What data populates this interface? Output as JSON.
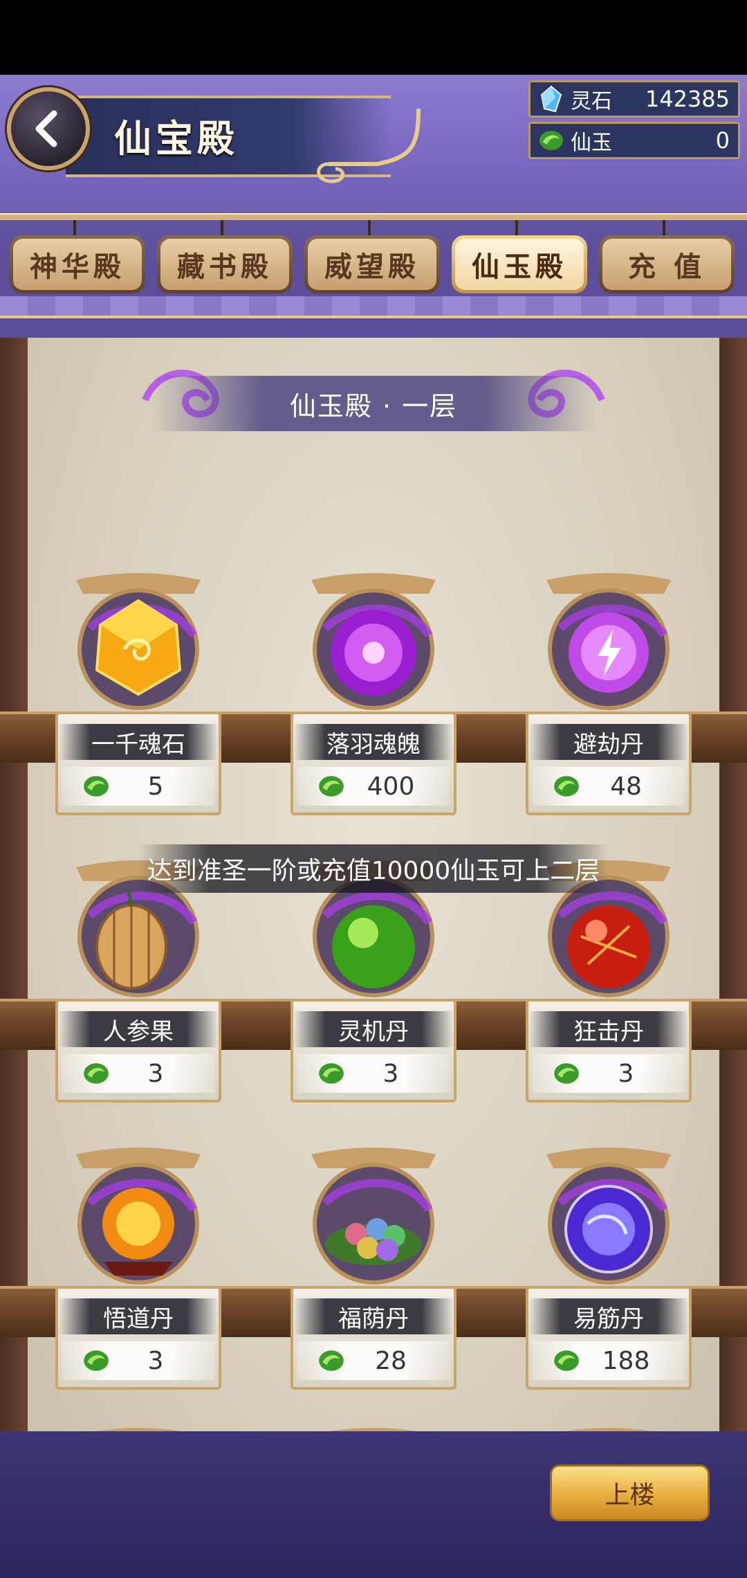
{
  "header": {
    "back_icon": "chevron-left-icon",
    "title": "仙宝殿"
  },
  "currencies": [
    {
      "icon": "spirit-stone-icon",
      "name": "灵石",
      "value": "142385"
    },
    {
      "icon": "jade-icon",
      "name": "仙玉",
      "value": "0"
    }
  ],
  "tabs": [
    {
      "label": "神华殿",
      "active": false
    },
    {
      "label": "藏书殿",
      "active": false
    },
    {
      "label": "威望殿",
      "active": false
    },
    {
      "label": "仙玉殿",
      "active": true
    },
    {
      "label": "充 值",
      "active": false
    }
  ],
  "floor": {
    "title": "仙玉殿 · 一层"
  },
  "items": [
    {
      "name": "一千魂石",
      "price": "5",
      "icon": "gold-soul-stone-icon"
    },
    {
      "name": "落羽魂魄",
      "price": "400",
      "icon": "purple-soul-orb-icon"
    },
    {
      "name": "避劫丹",
      "price": "48",
      "icon": "lightning-pill-icon"
    },
    {
      "name": "人参果",
      "price": "3",
      "icon": "ginseng-fruit-icon"
    },
    {
      "name": "灵机丹",
      "price": "3",
      "icon": "green-orb-icon"
    },
    {
      "name": "狂击丹",
      "price": "3",
      "icon": "red-orb-icon"
    },
    {
      "name": "悟道丹",
      "price": "3",
      "icon": "fire-orb-icon"
    },
    {
      "name": "福荫丹",
      "price": "28",
      "icon": "colored-pills-icon"
    },
    {
      "name": "易筋丹",
      "price": "188",
      "icon": "blue-orb-icon"
    }
  ],
  "toast": "达到准圣一阶或充值10000仙玉可上二层",
  "up_button": "上楼",
  "colors": {
    "accent_gold": "#e6a93a",
    "jade_green": "#3a9a2a",
    "purple_swirl": "#9b3fd6"
  }
}
